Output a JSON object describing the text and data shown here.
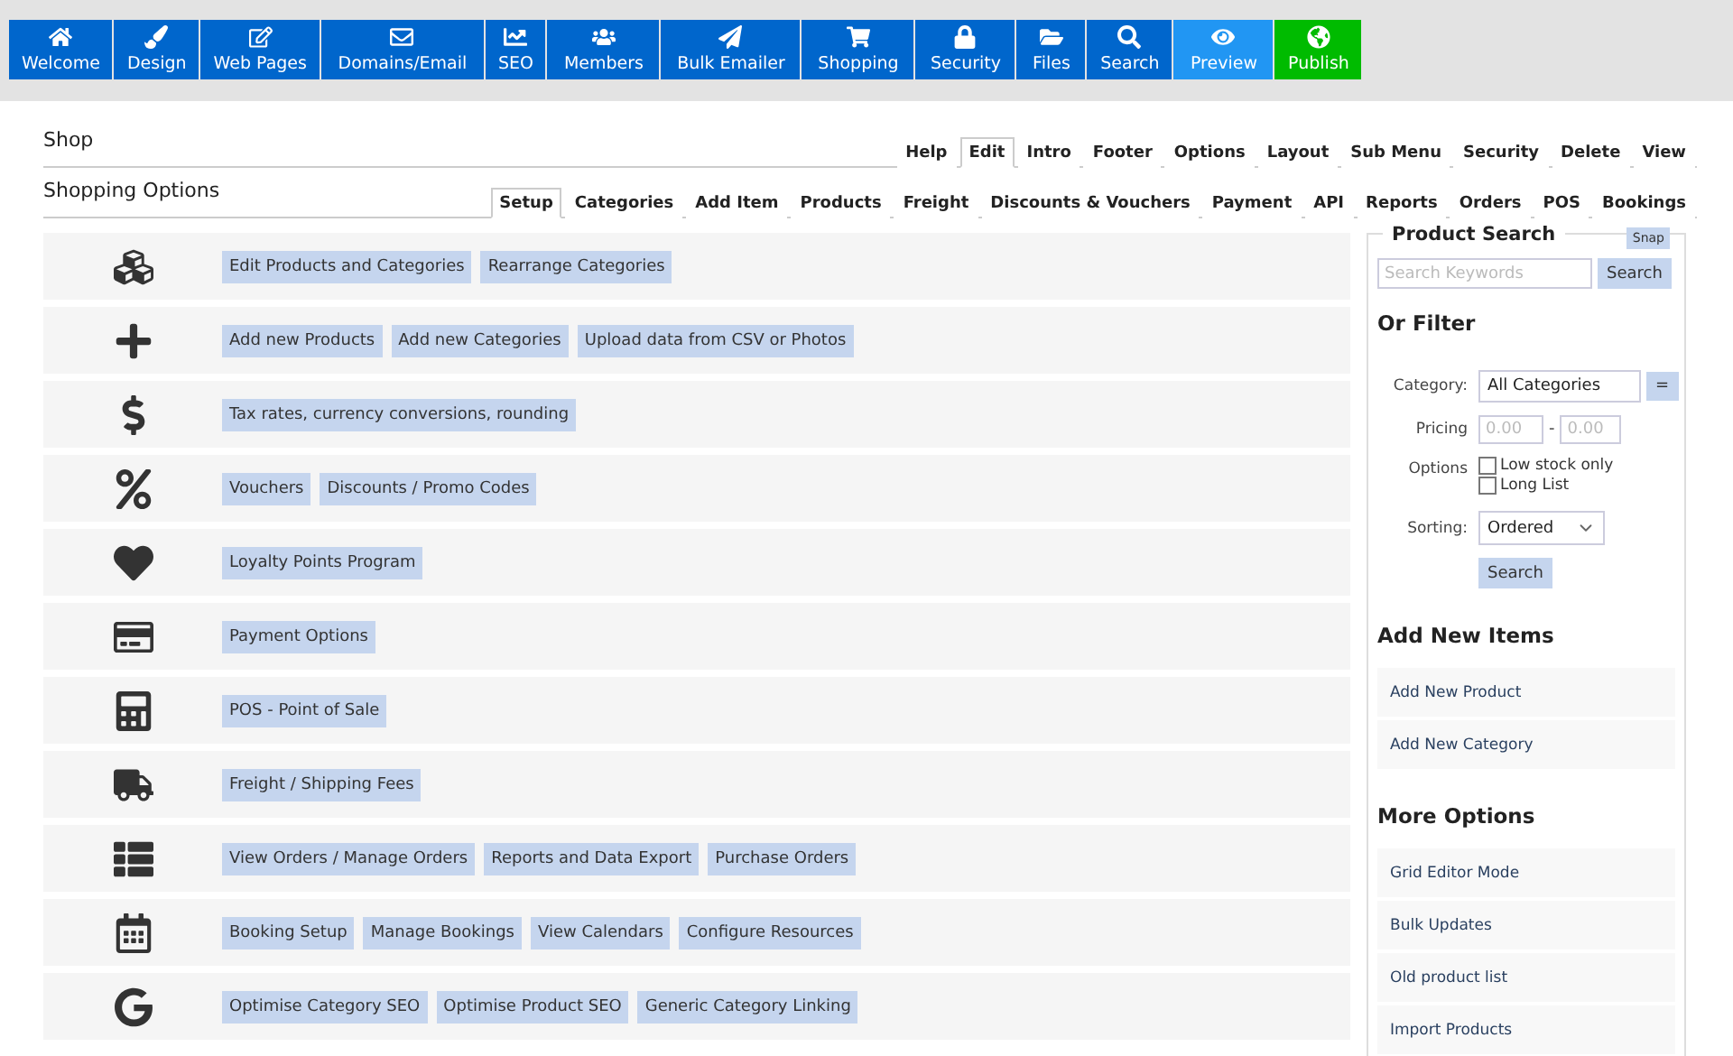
{
  "top_nav": [
    {
      "label": "Welcome",
      "kind": "normal"
    },
    {
      "label": "Design",
      "kind": "normal"
    },
    {
      "label": "Web Pages",
      "kind": "normal"
    },
    {
      "label": "Domains/Email",
      "kind": "normal"
    },
    {
      "label": "SEO",
      "kind": "normal"
    },
    {
      "label": "Members",
      "kind": "normal"
    },
    {
      "label": "Bulk Emailer",
      "kind": "normal"
    },
    {
      "label": "Shopping",
      "kind": "normal"
    },
    {
      "label": "Security",
      "kind": "normal"
    },
    {
      "label": "Files",
      "kind": "normal"
    },
    {
      "label": "Search",
      "kind": "normal"
    },
    {
      "label": "Preview",
      "kind": "preview"
    },
    {
      "label": "Publish",
      "kind": "publish"
    }
  ],
  "header": {
    "title": "Shop",
    "tabs": [
      {
        "label": "Help",
        "selected": false
      },
      {
        "label": "Edit",
        "selected": true
      },
      {
        "label": "Intro",
        "selected": false
      },
      {
        "label": "Footer",
        "selected": false
      },
      {
        "label": "Options",
        "selected": false
      },
      {
        "label": "Layout",
        "selected": false
      },
      {
        "label": "Sub Menu",
        "selected": false
      },
      {
        "label": "Security",
        "selected": false
      },
      {
        "label": "Delete",
        "selected": false
      },
      {
        "label": "View",
        "selected": false
      }
    ]
  },
  "subheader": {
    "title": "Shopping Options",
    "tabs": [
      {
        "label": "Setup",
        "selected": true
      },
      {
        "label": "Categories",
        "selected": false
      },
      {
        "label": "Add Item",
        "selected": false
      },
      {
        "label": "Products",
        "selected": false
      },
      {
        "label": "Freight",
        "selected": false
      },
      {
        "label": "Discounts & Vouchers",
        "selected": false
      },
      {
        "label": "Payment",
        "selected": false
      },
      {
        "label": "API",
        "selected": false
      },
      {
        "label": "Reports",
        "selected": false
      },
      {
        "label": "Orders",
        "selected": false
      },
      {
        "label": "POS",
        "selected": false
      },
      {
        "label": "Bookings",
        "selected": false
      }
    ]
  },
  "sections": [
    {
      "links": [
        "Edit Products and Categories",
        "Rearrange Categories"
      ]
    },
    {
      "links": [
        "Add new Products",
        "Add new Categories",
        "Upload data from CSV or Photos"
      ]
    },
    {
      "links": [
        "Tax rates, currency conversions, rounding"
      ]
    },
    {
      "links": [
        "Vouchers",
        "Discounts / Promo Codes"
      ]
    },
    {
      "links": [
        "Loyalty Points Program"
      ]
    },
    {
      "links": [
        "Payment Options"
      ]
    },
    {
      "links": [
        "POS - Point of Sale"
      ]
    },
    {
      "links": [
        "Freight / Shipping Fees"
      ]
    },
    {
      "links": [
        "View Orders / Manage Orders",
        "Reports and Data Export",
        "Purchase Orders"
      ]
    },
    {
      "links": [
        "Booking Setup",
        "Manage Bookings",
        "View Calendars",
        "Configure Resources"
      ]
    },
    {
      "links": [
        "Optimise Category SEO",
        "Optimise Product SEO",
        "Generic Category Linking"
      ]
    }
  ],
  "product_search": {
    "title": "Product Search",
    "snap": "Snap",
    "search": {
      "placeholder": "Search Keywords",
      "button": "Search"
    },
    "filter_title": "Or Filter",
    "category": {
      "label": "Category:",
      "value": "All Categories",
      "button": "="
    },
    "pricing": {
      "label": "Pricing",
      "from": {
        "placeholder": "0.00"
      },
      "separator": "-",
      "to": {
        "placeholder": "0.00"
      }
    },
    "options": {
      "label": "Options",
      "items": [
        {
          "label": "Low stock only",
          "checked": false
        },
        {
          "label": "Long List",
          "checked": false
        }
      ]
    },
    "sorting": {
      "label": "Sorting:",
      "value": "Ordered"
    },
    "search_button": "Search"
  },
  "add_new_items": {
    "title": "Add New Items",
    "items": [
      "Add New Product",
      "Add New Category"
    ]
  },
  "more_options": {
    "title": "More Options",
    "items": [
      "Grid Editor Mode",
      "Bulk Updates",
      "Old product list",
      "Import Products"
    ]
  }
}
